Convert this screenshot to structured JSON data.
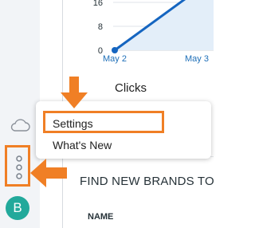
{
  "chart": {
    "y_ticks": [
      "16",
      "8",
      "0"
    ],
    "x_ticks": [
      "May 2",
      "May 3"
    ],
    "line_color": "#1565c0",
    "fill_color": "#e3eef9"
  },
  "chart_data": {
    "type": "area",
    "x": [
      "May 2",
      "May 3"
    ],
    "series": [
      {
        "values": [
          0,
          20
        ]
      }
    ],
    "ylim": [
      0,
      16
    ],
    "grid": true
  },
  "clicks_title": "Clicks",
  "section_title": "FIND NEW BRANDS TO",
  "column_header": "NAME",
  "menu": {
    "items": [
      "Settings",
      "What's New"
    ]
  },
  "rail": {
    "avatar_letter": "B",
    "icons": [
      "cloud-icon",
      "more-vertical-icon"
    ]
  },
  "colors": {
    "accent": "#f07f25",
    "avatar": "#22a99b",
    "rail": "#f2f4f7"
  }
}
